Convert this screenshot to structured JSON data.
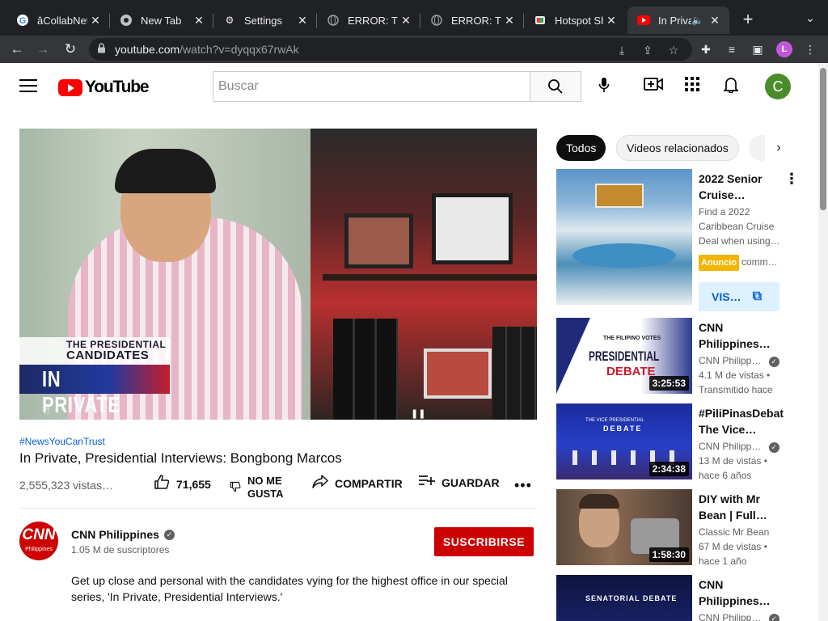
{
  "browser": {
    "tabs": [
      {
        "title": "âCollabNet",
        "icon": "google-g"
      },
      {
        "title": "New Tab",
        "icon": "chrome-icon"
      },
      {
        "title": "Settings",
        "icon": "gear-icon"
      },
      {
        "title": "ERROR: Th",
        "icon": "globe-icon"
      },
      {
        "title": "ERROR: Th",
        "icon": "globe-icon"
      },
      {
        "title": "Hotspot Sh",
        "icon": "hotspot-icon"
      },
      {
        "title": "In Priva",
        "icon": "youtube-icon"
      }
    ],
    "url_host": "youtube.com",
    "url_path": "/watch?v=dyqqx67rwAk",
    "profile_initial": "L"
  },
  "masthead": {
    "logo_text": "YouTube",
    "search_placeholder": "Buscar",
    "avatar_initial": "C"
  },
  "video": {
    "overlay_line1": "THE PRESIDENTIAL",
    "overlay_line2": "CANDIDATES",
    "overlay_line3": "IN PRIVATE",
    "hashtag": "#NewsYouCanTrust",
    "title": "In Private, Presidential Interviews: Bongbong Marcos",
    "views": "2,555,323 vistas…",
    "likes": "71,655",
    "dislike_label_1": "NO ME",
    "dislike_label_2": "GUSTA",
    "share_label": "COMPARTIR",
    "save_label": "GUARDAR"
  },
  "channel": {
    "name": "CNN Philippines",
    "logo_text": "CNN",
    "logo_sub": "Philippines",
    "subscribers": "1.05 M de suscriptores",
    "subscribe_label": "SUSCRIBIRSE",
    "description": "Get up close and personal with the candidates vying for the highest office in our special series, 'In Private, Presidential Interviews.'"
  },
  "sidebar": {
    "chips": [
      "Todos",
      "Videos relacionados"
    ],
    "ad": {
      "title": "2022 Senior Cruise…",
      "desc_1": "Find a 2022",
      "desc_2": "Caribbean Cruise",
      "desc_3": "Deal when using…",
      "badge": "Anuncio",
      "advertiser": "comm…",
      "visit_label": "VIS…"
    },
    "videos": [
      {
        "title_1": "CNN",
        "title_2": "Philippines…",
        "channel": "CNN Philipp…",
        "views": "4.1 M de vistas •",
        "age": "Transmitido hace",
        "duration": "3:25:53",
        "thumb_text_1": "THE FILIPINO VOTES",
        "thumb_text_2": "PRESIDENTIAL",
        "thumb_text_3": "DEBATE"
      },
      {
        "title_1": "#PiliPinasDebat",
        "title_2": "The Vice…",
        "channel": "CNN Philipp…",
        "views": "13 M de vistas •",
        "age": "hace 6 años",
        "duration": "2:34:38",
        "thumb_text_1": "THE VICE PRESIDENTIAL",
        "thumb_text_2": "DEBATE"
      },
      {
        "title_1": "DIY with Mr",
        "title_2": "Bean | Full…",
        "channel": "Classic Mr Bean",
        "views": "67 M de vistas •",
        "age": "hace 1 año",
        "duration": "1:58:30"
      },
      {
        "title_1": "CNN",
        "title_2": "Philippines…",
        "channel": "CNN Philipp…",
        "thumb_text_1": "SENATORIAL DEBATE"
      }
    ]
  }
}
